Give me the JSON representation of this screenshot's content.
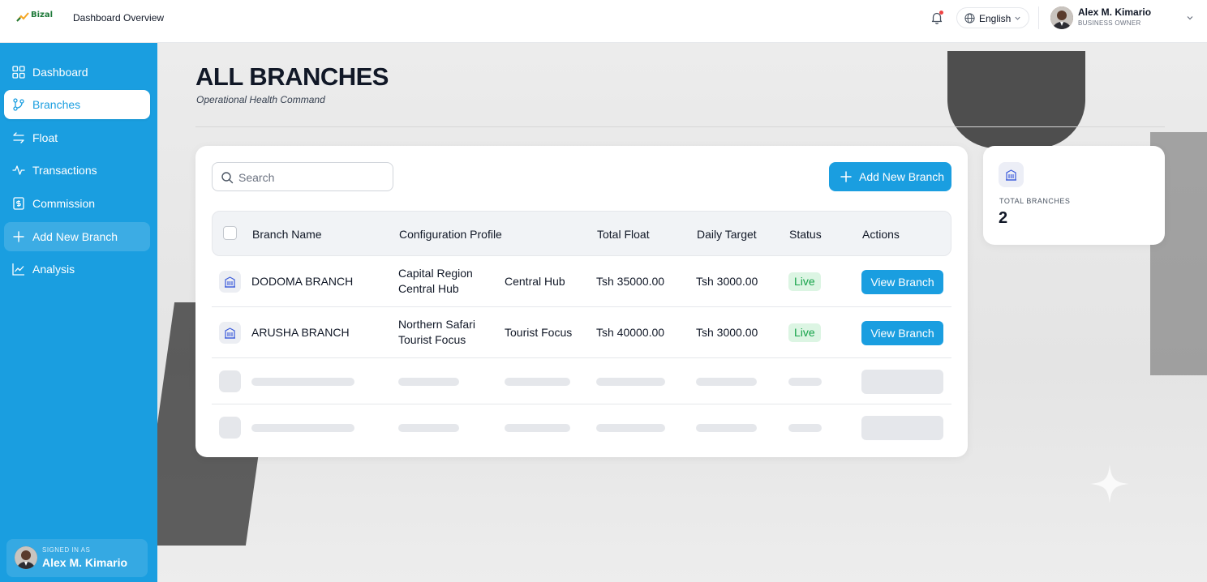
{
  "app": {
    "logo_text": "Bizal",
    "header_title": "Dashboard Overview"
  },
  "header": {
    "language": "English",
    "user_name": "Alex M. Kimario",
    "user_role": "BUSINESS OWNER",
    "icons": [
      "bell-icon",
      "globe-icon",
      "chevron-down-icon"
    ]
  },
  "sidebar": {
    "items": [
      {
        "label": "Dashboard",
        "icon": "grid-icon"
      },
      {
        "label": "Branches",
        "icon": "branch-icon",
        "active": true
      },
      {
        "label": "Float",
        "icon": "swap-icon"
      },
      {
        "label": "Transactions",
        "icon": "activity-icon"
      },
      {
        "label": "Commission",
        "icon": "receipt-icon"
      },
      {
        "label": "Add New Branch",
        "icon": "plus-icon"
      },
      {
        "label": "Analysis",
        "icon": "chart-icon"
      }
    ],
    "signed_in_caption": "SIGNED IN AS",
    "signed_in_name": "Alex M. Kimario"
  },
  "page": {
    "title": "ALL BRANCHES",
    "subtitle": "Operational Health Command"
  },
  "table": {
    "search_placeholder": "Search",
    "add_button": "Add New Branch",
    "columns": [
      "Branch Name",
      "Configuration Profile",
      "Total Float",
      "Daily Target",
      "Status",
      "Actions"
    ],
    "rows": [
      {
        "name": "DODOMA BRANCH",
        "profile_line1": "Capital Region",
        "profile_line2": "Central Hub",
        "profile_tag": "Central Hub",
        "total_float": "Tsh 35000.00",
        "daily_target": "Tsh 3000.00",
        "status": "Live",
        "action": "View Branch"
      },
      {
        "name": "ARUSHA BRANCH",
        "profile_line1": "Northern Safari",
        "profile_line2": "Tourist Focus",
        "profile_tag": "Tourist Focus",
        "total_float": "Tsh 40000.00",
        "daily_target": "Tsh 3000.00",
        "status": "Live",
        "action": "View Branch"
      }
    ],
    "loading_rows": 2
  },
  "stats": {
    "total_branches_label": "TOTAL BRANCHES",
    "total_branches_value": "2"
  },
  "colors": {
    "primary": "#1a9ee0",
    "live_bg": "#dcf5e3",
    "live_text": "#16a34a"
  }
}
